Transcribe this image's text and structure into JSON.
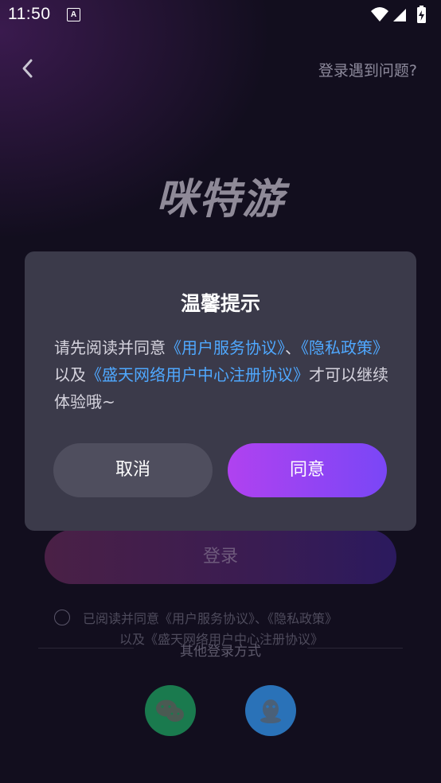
{
  "status_bar": {
    "time": "11:50",
    "badge": "A"
  },
  "header": {
    "help_link": "登录遇到问题?"
  },
  "logo_text": "咪特游",
  "login_button": "登录",
  "agreement": {
    "line1": "已阅读并同意《用户服务协议》、《隐私政策》",
    "line2": "以及《盛天网络用户中心注册协议》"
  },
  "other_login": {
    "title": "其他登录方式",
    "icons": [
      "wechat-icon",
      "qq-icon"
    ]
  },
  "dialog": {
    "title": "温馨提示",
    "msg_pre": "请先阅读并同意",
    "link1": "《用户服务协议》",
    "sep": "、",
    "link2": "《隐私政策》",
    "mid": "以及",
    "link3": "《盛天网络用户中心注册协议》",
    "msg_post": "才可以继续体验哦~",
    "cancel": "取消",
    "confirm": "同意"
  },
  "colors": {
    "link": "#4fa8ff",
    "dialog_bg": "#3b3a4a",
    "accent_start": "#b042f0",
    "accent_end": "#7a46f6"
  }
}
